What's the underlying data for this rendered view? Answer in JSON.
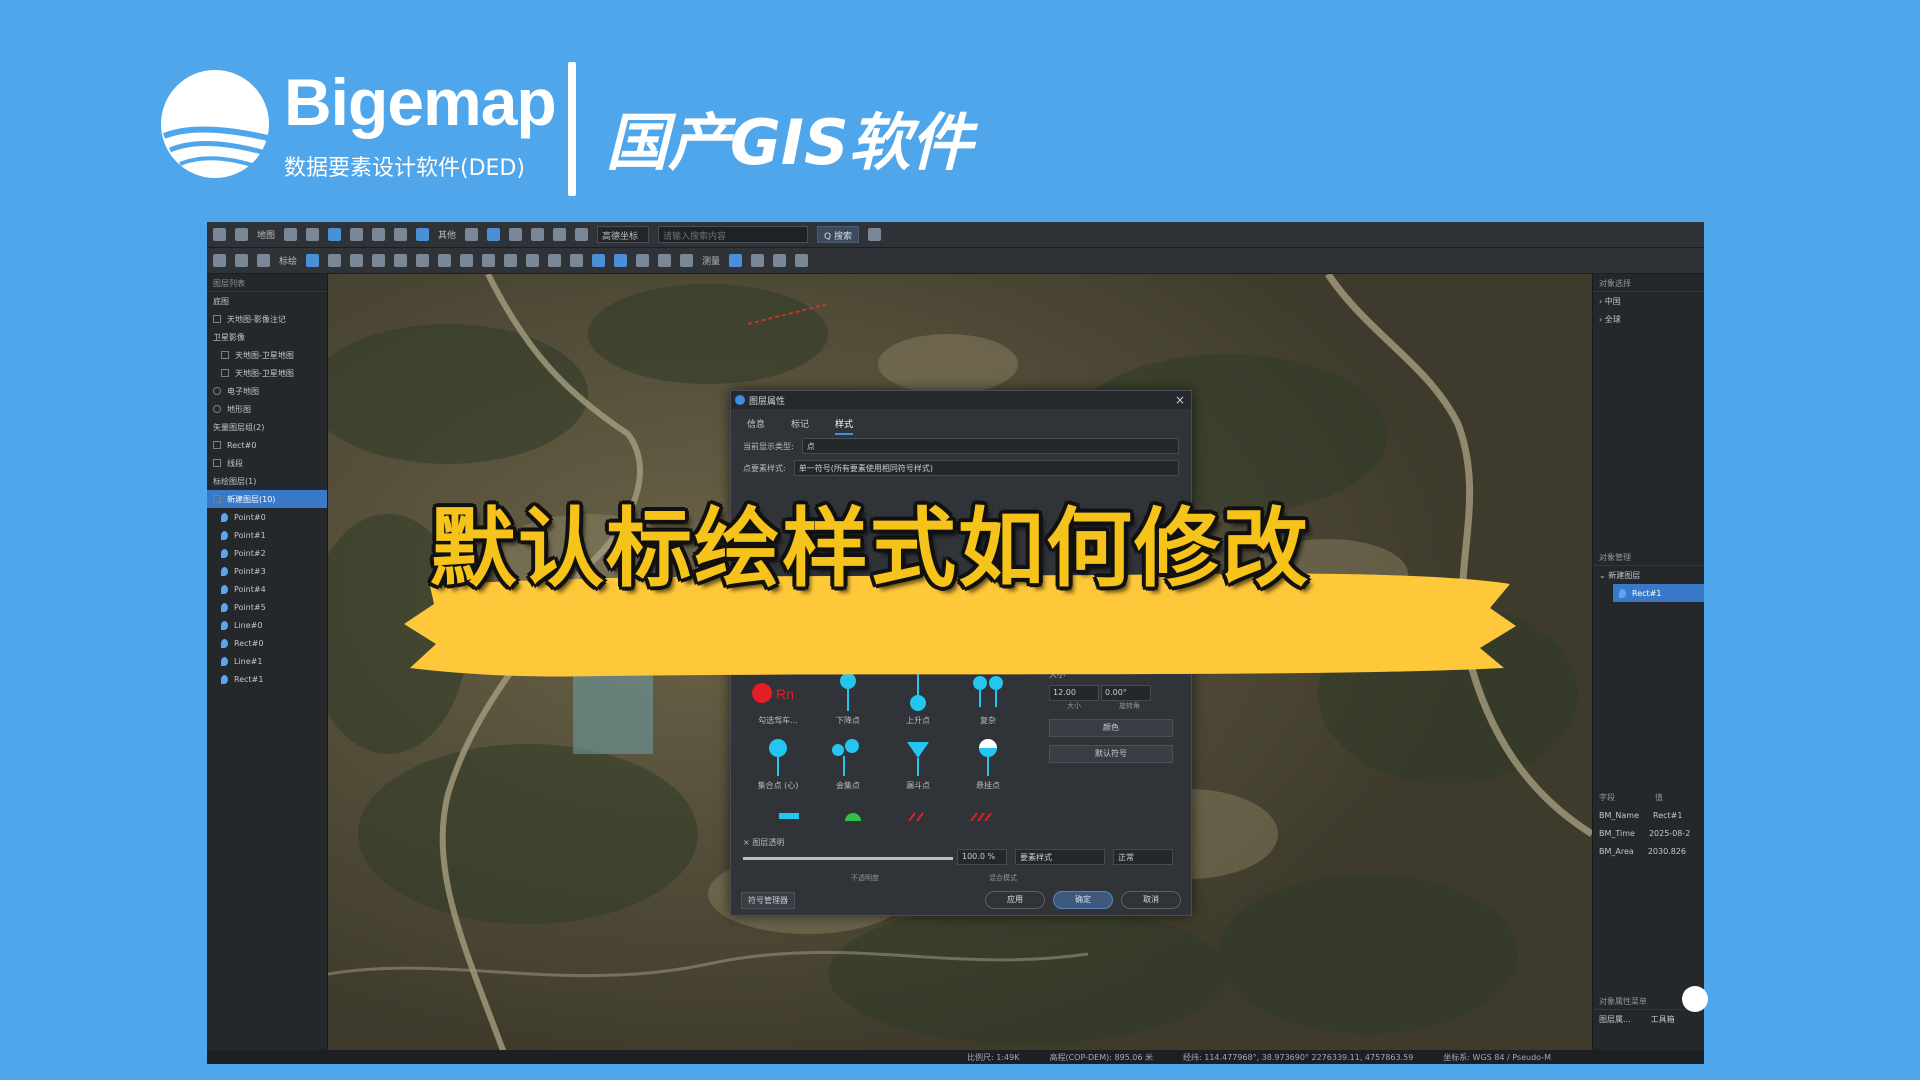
{
  "brand": {
    "name": "Bigemap",
    "subtitle": "数据要素设计软件(DED)",
    "slogan": "国产GIS软件"
  },
  "headline": "默认标绘样式如何修改",
  "colors": {
    "background": "#4fa6ea",
    "headline": "#f5c31a",
    "banner": "#ffc83a",
    "accent": "#3a79c9"
  },
  "toolbar": {
    "map_label": "地图",
    "other_label": "其他",
    "coord_select": "高德坐标",
    "search_placeholder": "请输入搜索内容",
    "search_button": "Q 搜索",
    "draw_label": "标绘",
    "measure_label": "测量"
  },
  "left_panel": {
    "header": "图层列表",
    "rows": [
      {
        "label": "底图",
        "type": "group"
      },
      {
        "label": "天地图-影像注记",
        "type": "item"
      },
      {
        "label": "卫星影像",
        "type": "group"
      },
      {
        "label": "天地图-卫星地图",
        "type": "sub"
      },
      {
        "label": "天地图-卫星地图",
        "type": "sub"
      },
      {
        "label": "电子地图",
        "type": "radio"
      },
      {
        "label": "地形图",
        "type": "radio"
      },
      {
        "label": "矢量图层组(2)",
        "type": "group"
      },
      {
        "label": "Rect#0",
        "type": "item"
      },
      {
        "label": "线段",
        "type": "item"
      },
      {
        "label": "标绘图层(1)",
        "type": "group"
      },
      {
        "label": "新建图层(10)",
        "type": "selected"
      },
      {
        "label": "Point#0",
        "type": "point"
      },
      {
        "label": "Point#1",
        "type": "point"
      },
      {
        "label": "Point#2",
        "type": "point"
      },
      {
        "label": "Point#3",
        "type": "point"
      },
      {
        "label": "Point#4",
        "type": "point"
      },
      {
        "label": "Point#5",
        "type": "point"
      },
      {
        "label": "Line#0",
        "type": "point"
      },
      {
        "label": "Rect#0",
        "type": "point"
      },
      {
        "label": "Line#1",
        "type": "point"
      },
      {
        "label": "Rect#1",
        "type": "point"
      }
    ]
  },
  "right_panel": {
    "top_header": "对象选择",
    "top_items": [
      "中国",
      "全球"
    ],
    "mid_header": "对象管理",
    "tree_group": "新建图层",
    "tree_selected": "Rect#1",
    "attr_headers": [
      "字段",
      "值"
    ],
    "attrs": [
      {
        "k": "BM_Name",
        "v": "Rect#1"
      },
      {
        "k": "BM_Time",
        "v": "2025-08-2"
      },
      {
        "k": "BM_Area",
        "v": "2030.826"
      }
    ],
    "bottom_header": "对象属性菜单",
    "bottom_tabs": [
      "图层属...",
      "工具箱"
    ]
  },
  "dialog": {
    "title": "图层属性",
    "tabs": [
      "信息",
      "标记",
      "样式"
    ],
    "active_tab": 2,
    "fields": [
      {
        "label": "当前显示类型:",
        "value": "点"
      },
      {
        "label": "点要素样式:",
        "value": "单一符号(所有要素使用相同符号样式)"
      }
    ],
    "symbols": [
      {
        "label": "勾选驾车..."
      },
      {
        "label": "下降点"
      },
      {
        "label": "上升点"
      },
      {
        "label": "复杂"
      },
      {
        "label": "集合点 (心)"
      },
      {
        "label": "会集点"
      },
      {
        "label": "漏斗点"
      },
      {
        "label": "悬挂点"
      }
    ],
    "size_header": "大小",
    "size_value": "12.00",
    "angle_value": "0.00°",
    "size_sub": [
      "大小",
      "旋转角"
    ],
    "btn1": "颜色",
    "btn2": "默认符号",
    "opacity_label": "× 图层透明",
    "opacity_value": "100.0 %",
    "opacity_fraction": 1.0,
    "blend_select": "要素样式",
    "mode_select": "正常",
    "opacity_sub": [
      "不透明度",
      "混合模式"
    ],
    "library_btn": "符号管理器",
    "ok": "确定",
    "apply": "应用",
    "cancel": "取消"
  },
  "statusbar": {
    "scale": "比例尺:  1:49K",
    "dem": "高程(COP-DEM): 895.06 米",
    "coords": "经纬: 114.477968°, 38.973690°  2276339.11, 4757863.59",
    "crs": "坐标系: WGS 84 / Pseudo-M"
  }
}
